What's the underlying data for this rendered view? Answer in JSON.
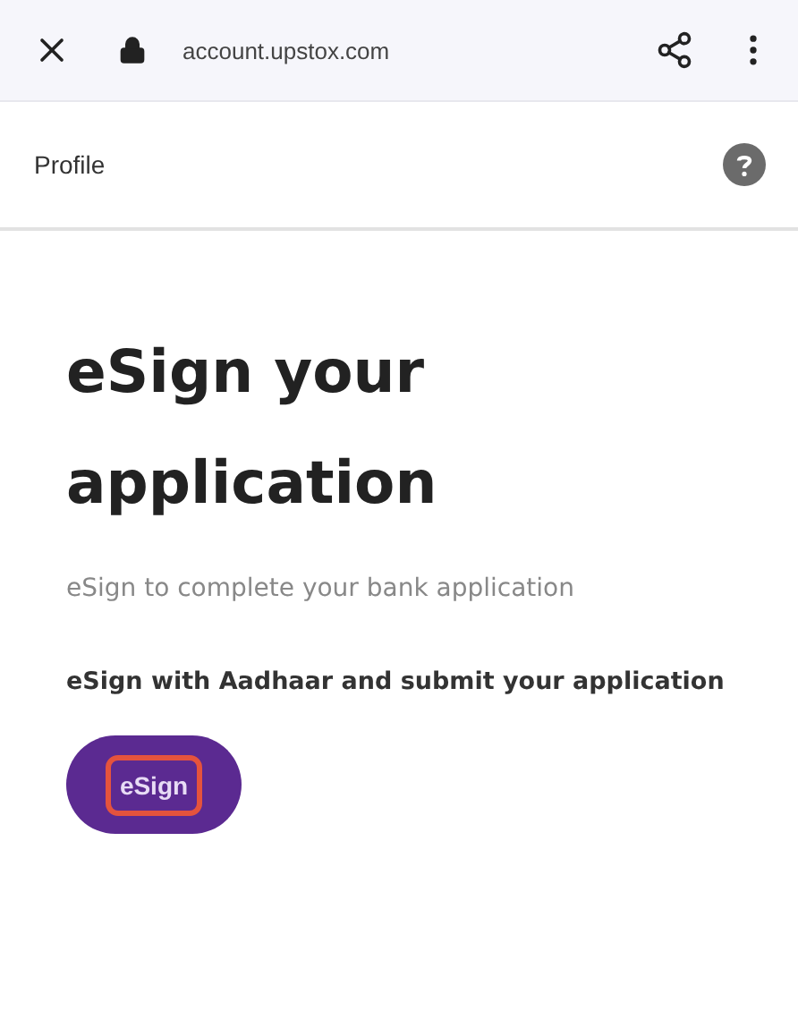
{
  "browser_bar": {
    "url": "account.upstox.com"
  },
  "header": {
    "title": "Profile"
  },
  "content": {
    "heading": "eSign your application",
    "subtitle": "eSign to complete your bank application",
    "instruction": "eSign with Aadhaar and submit your application",
    "button": {
      "label": "eSign",
      "highlighted": true
    }
  }
}
